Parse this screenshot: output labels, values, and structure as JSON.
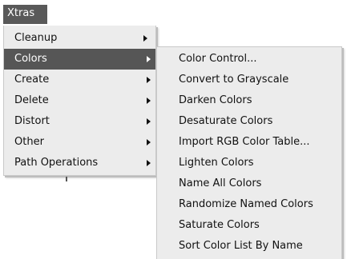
{
  "menubar": {
    "xtras_label": "Xtras"
  },
  "main_menu": {
    "items": [
      {
        "label": "Cleanup"
      },
      {
        "label": "Colors"
      },
      {
        "label": "Create"
      },
      {
        "label": "Delete"
      },
      {
        "label": "Distort"
      },
      {
        "label": "Other"
      },
      {
        "label": "Path Operations"
      }
    ],
    "highlighted": "Colors"
  },
  "submenu": {
    "items": [
      {
        "label": "Color Control..."
      },
      {
        "label": "Convert to Grayscale"
      },
      {
        "label": "Darken Colors"
      },
      {
        "label": "Desaturate Colors"
      },
      {
        "label": "Import RGB Color Table..."
      },
      {
        "label": "Lighten Colors"
      },
      {
        "label": "Name All Colors"
      },
      {
        "label": "Randomize Named Colors"
      },
      {
        "label": "Saturate Colors"
      },
      {
        "label": "Sort Color List By Name"
      }
    ]
  },
  "colors": {
    "highlight": "#565656",
    "menu_background": "#ececec",
    "highlight_text": "#ffffff"
  },
  "icons": {
    "submenu_indicator": "submenu-arrow-icon"
  }
}
